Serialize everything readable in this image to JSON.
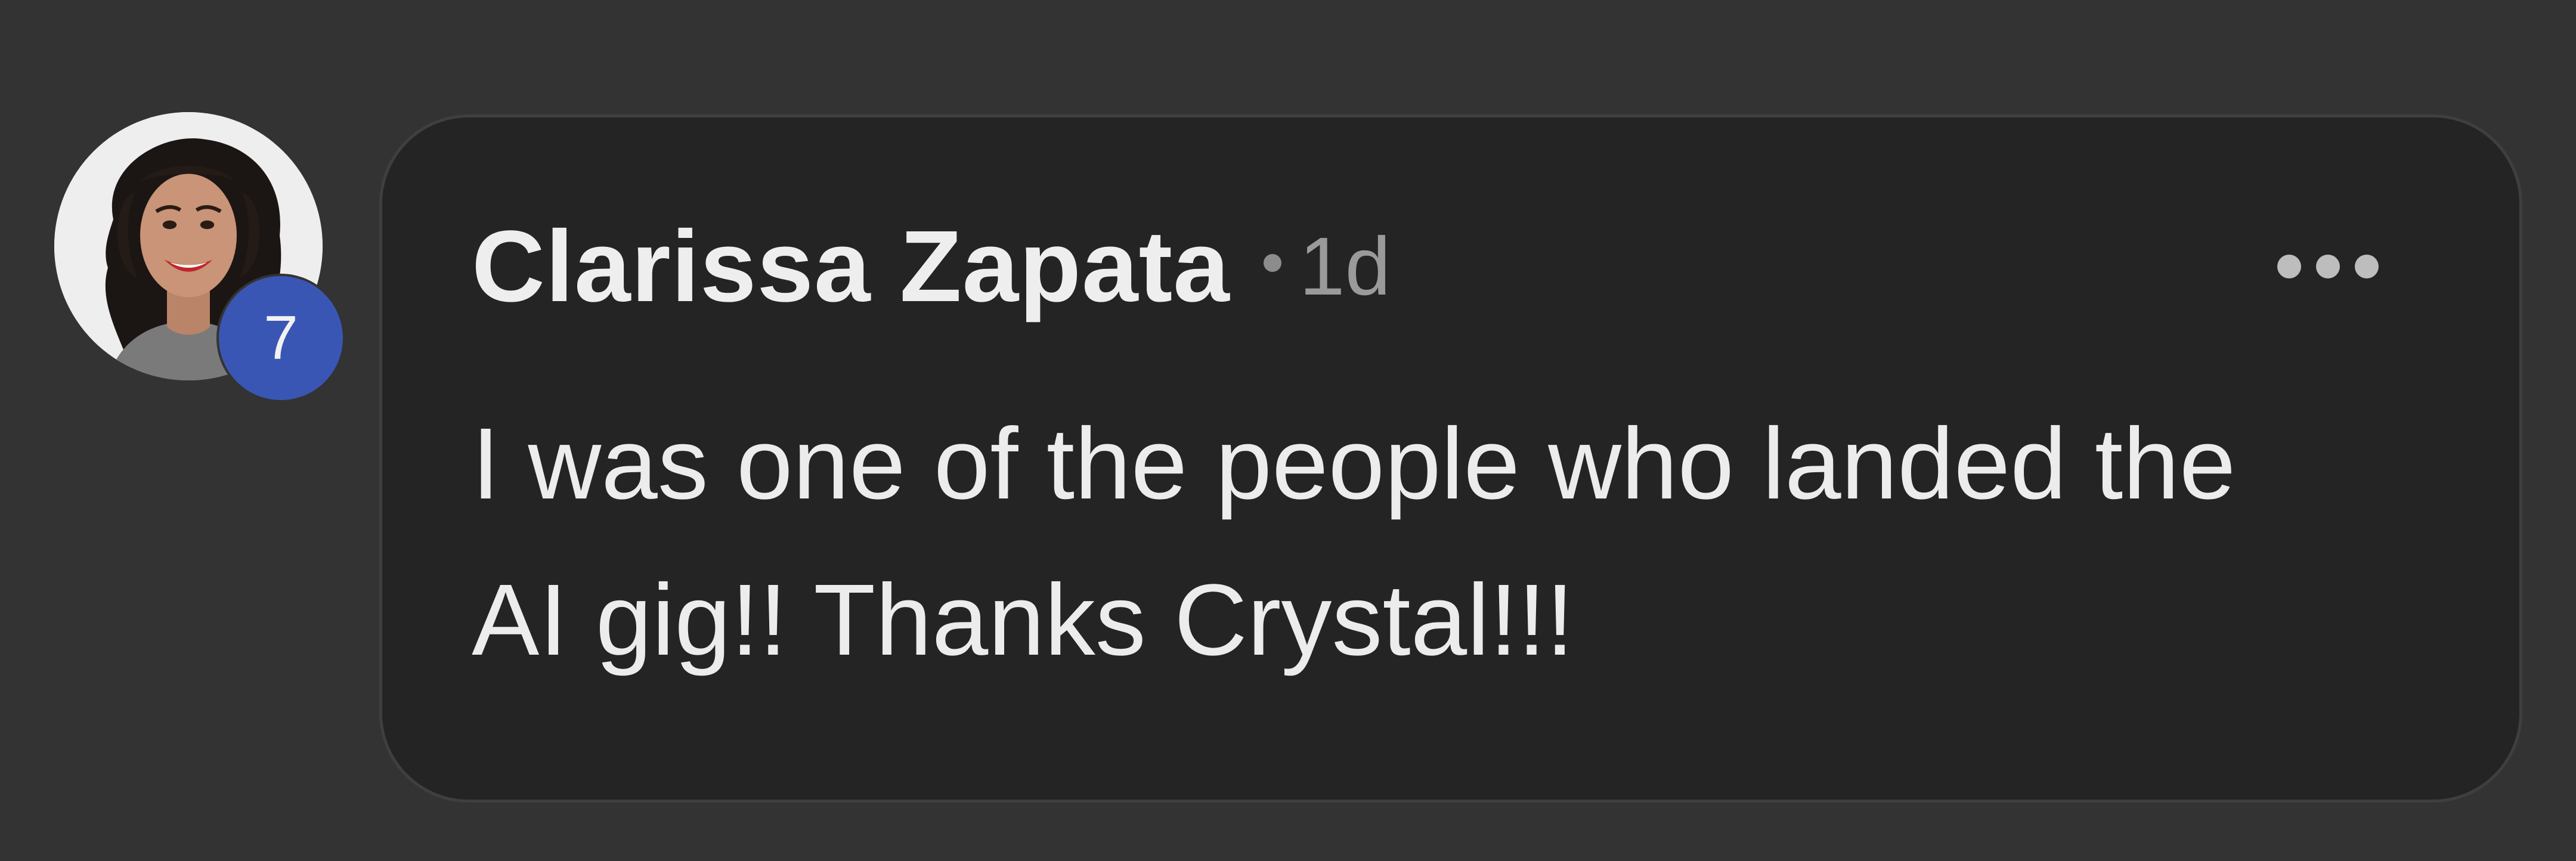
{
  "comment": {
    "author": "Clarissa Zapata",
    "timestamp": "1d",
    "text": "I was one of the people who landed the\nAI gig!! Thanks Crystal!!!",
    "avatar": {
      "badge_count": "7",
      "badge_color": "#3a56b4"
    },
    "more_icon": "more-horizontal-icon"
  },
  "colors": {
    "background": "#333333",
    "bubble": "#242424",
    "author_text": "#eeeeee",
    "meta_text": "#9a9a9a"
  }
}
